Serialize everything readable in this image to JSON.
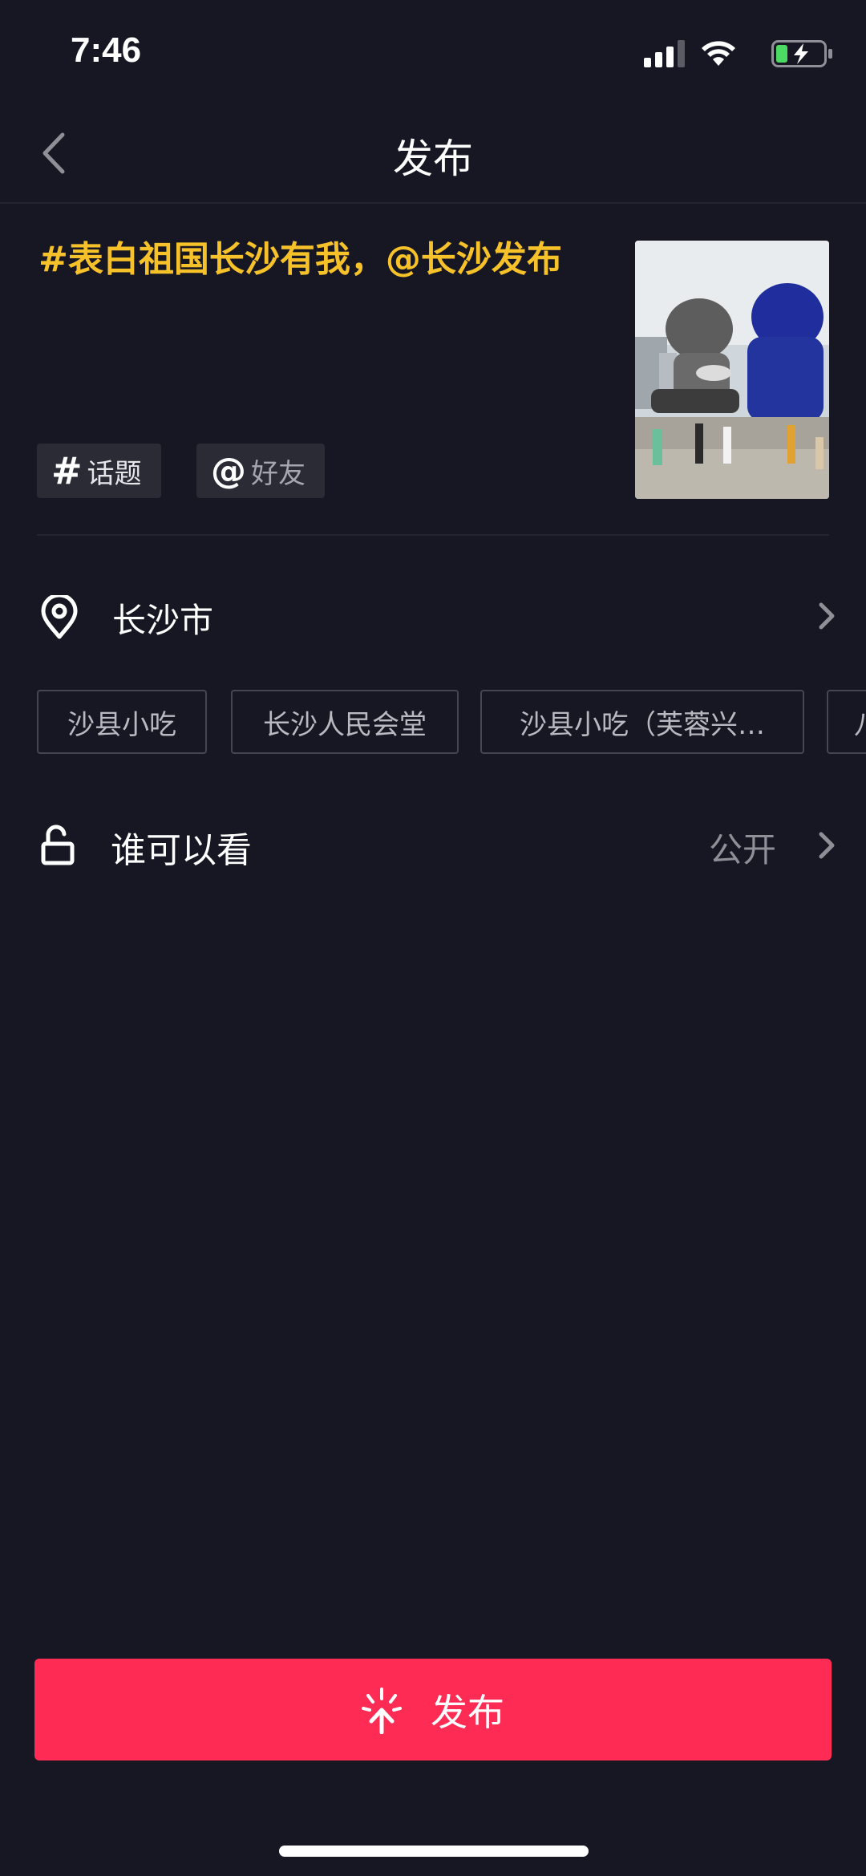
{
  "status_bar": {
    "time": "7:46"
  },
  "header": {
    "title": "发布"
  },
  "caption": {
    "hashtag": "#表白祖国长沙有我",
    "separator": "，",
    "mention": "@长沙发布"
  },
  "chips": {
    "topic": "话题",
    "friend": "好友"
  },
  "location": {
    "label": "长沙市"
  },
  "suggestions": [
    "沙县小吃",
    "长沙人民会堂",
    "沙县小吃（芙蓉兴…",
    "八"
  ],
  "visibility": {
    "label": "谁可以看",
    "value": "公开"
  },
  "publish_button": {
    "label": "发布"
  },
  "icons": {
    "back": "chevron-left-icon",
    "signal": "signal-icon",
    "wifi": "wifi-icon",
    "battery": "battery-charging-icon",
    "location": "location-pin-icon",
    "lock": "unlock-icon",
    "publish": "upload-spark-icon"
  },
  "colors": {
    "background": "#161722",
    "accent": "#fe2c55",
    "caption": "#f7c229",
    "battery": "#4cd964"
  }
}
